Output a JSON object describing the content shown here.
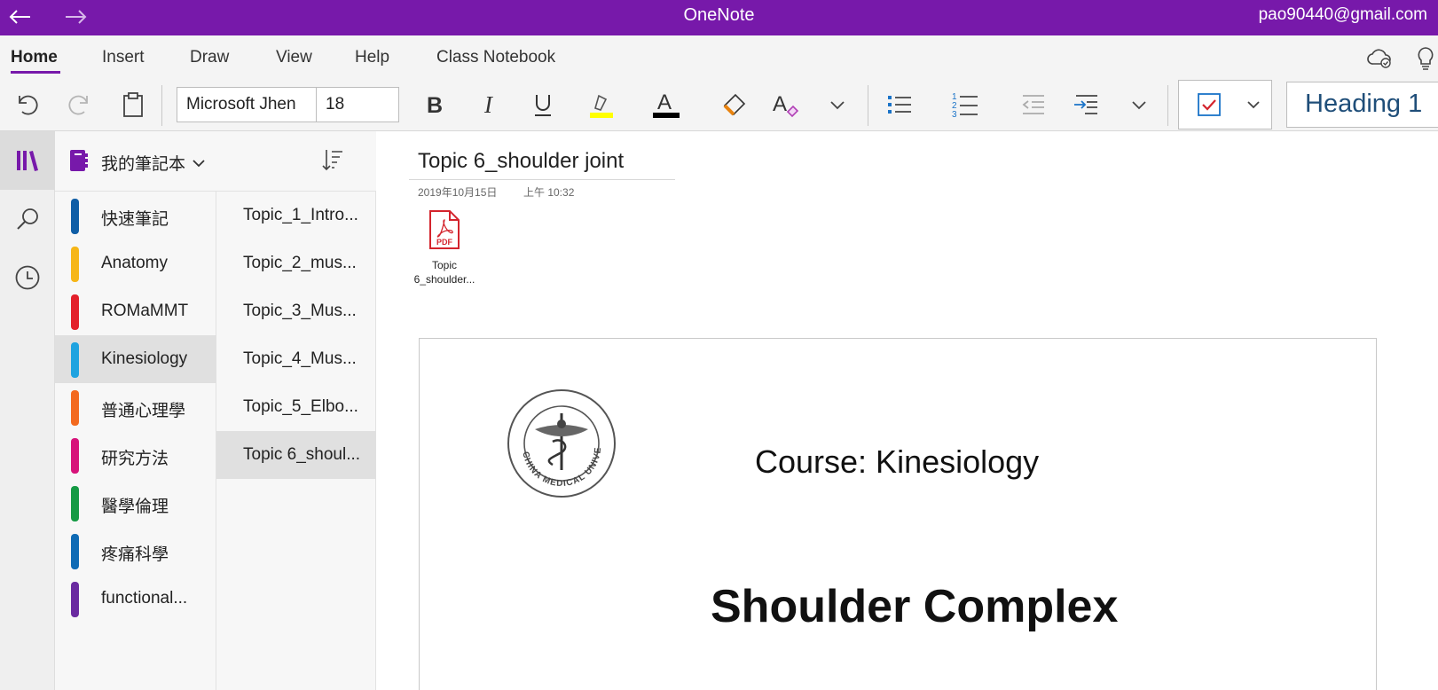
{
  "app": {
    "title": "OneNote",
    "account": "pao90440@gmail.com",
    "accent": "#7719aa"
  },
  "ribbon": {
    "tabs": [
      "Home",
      "Insert",
      "Draw",
      "View",
      "Help",
      "Class Notebook"
    ],
    "active_tab": "Home"
  },
  "toolbar": {
    "font_name": "Microsoft Jhen",
    "font_size": "18",
    "style": "Heading 1",
    "highlight_color": "#ffff00",
    "font_color": "#000000"
  },
  "notebook": {
    "name": "我的筆記本",
    "sections": [
      {
        "label": "快速筆記",
        "color": "#0f5ea6"
      },
      {
        "label": "Anatomy",
        "color": "#f6b617"
      },
      {
        "label": "ROMaMMT",
        "color": "#e3202b"
      },
      {
        "label": "Kinesiology",
        "color": "#1fa3e0",
        "selected": true
      },
      {
        "label": "普通心理學",
        "color": "#f36a1f"
      },
      {
        "label": "研究方法",
        "color": "#d7137a"
      },
      {
        "label": "醫學倫理",
        "color": "#159a44"
      },
      {
        "label": "疼痛科學",
        "color": "#0f6bb5"
      },
      {
        "label": "functional...",
        "color": "#6a2aa0"
      }
    ],
    "pages": [
      {
        "label": "Topic_1_Intro..."
      },
      {
        "label": "Topic_2_mus..."
      },
      {
        "label": "Topic_3_Mus..."
      },
      {
        "label": "Topic_4_Mus..."
      },
      {
        "label": "Topic_5_Elbo..."
      },
      {
        "label": "Topic 6_shoul...",
        "selected": true
      }
    ]
  },
  "page": {
    "title": "Topic 6_shoulder joint",
    "date": "2019年10月15日",
    "time": "上午 10:32",
    "attachment": {
      "type_label": "PDF",
      "caption_line1": "Topic",
      "caption_line2": "6_shoulder..."
    },
    "slide": {
      "course": "Course: Kinesiology",
      "headline": "Shoulder Complex",
      "seal_text": "CHINA MEDICAL UNIVERSITY"
    }
  }
}
